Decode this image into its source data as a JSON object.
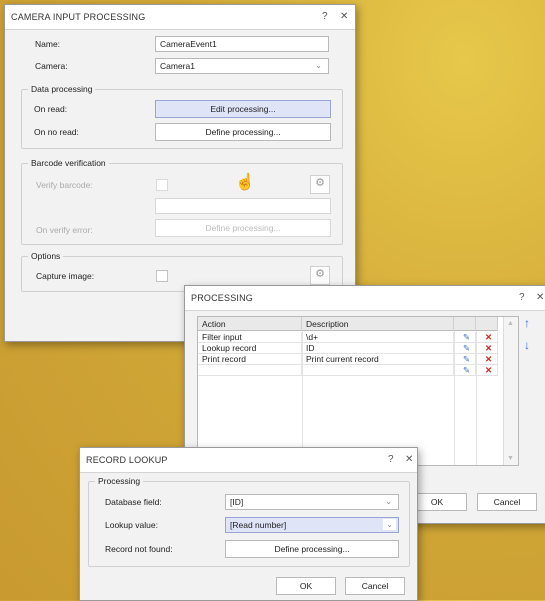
{
  "camera_dialog": {
    "title": "CAMERA INPUT PROCESSING",
    "help": "?",
    "close": "✕",
    "name_label": "Name:",
    "name_value": "CameraEvent1",
    "camera_label": "Camera:",
    "camera_value": "Camera1",
    "data_processing": {
      "legend": "Data processing",
      "on_read_label": "On read:",
      "on_read_button": "Edit processing...",
      "on_no_read_label": "On no read:",
      "on_no_read_button": "Define processing..."
    },
    "barcode_verification": {
      "legend": "Barcode verification",
      "verify_label": "Verify barcode:",
      "verify_field_value": "",
      "on_error_label": "On verify error:",
      "on_error_button": "Define processing..."
    },
    "options": {
      "legend": "Options",
      "capture_label": "Capture image:"
    }
  },
  "processing_dialog": {
    "title": "PROCESSING",
    "help": "?",
    "close": "✕",
    "columns": [
      "Action",
      "Description"
    ],
    "rows": [
      {
        "action": "Filter input",
        "description": "\\d+"
      },
      {
        "action": "Lookup record",
        "description": "ID"
      },
      {
        "action": "Print record",
        "description": "Print current record"
      },
      {
        "action": "",
        "description": ""
      }
    ],
    "ok": "OK",
    "cancel": "Cancel"
  },
  "lookup_dialog": {
    "title": "RECORD LOOKUP",
    "help": "?",
    "close": "✕",
    "legend": "Processing",
    "db_field_label": "Database field:",
    "db_field_value": "[ID]",
    "lookup_label": "Lookup value:",
    "lookup_value": "[Read number]",
    "not_found_label": "Record not found:",
    "not_found_button": "Define processing...",
    "ok": "OK",
    "cancel": "Cancel"
  },
  "icons": {
    "edit": "✎",
    "delete": "✕",
    "gear": "⚙",
    "up": "↑",
    "down": "↓",
    "chevron": "⌄",
    "hand": "☝"
  }
}
